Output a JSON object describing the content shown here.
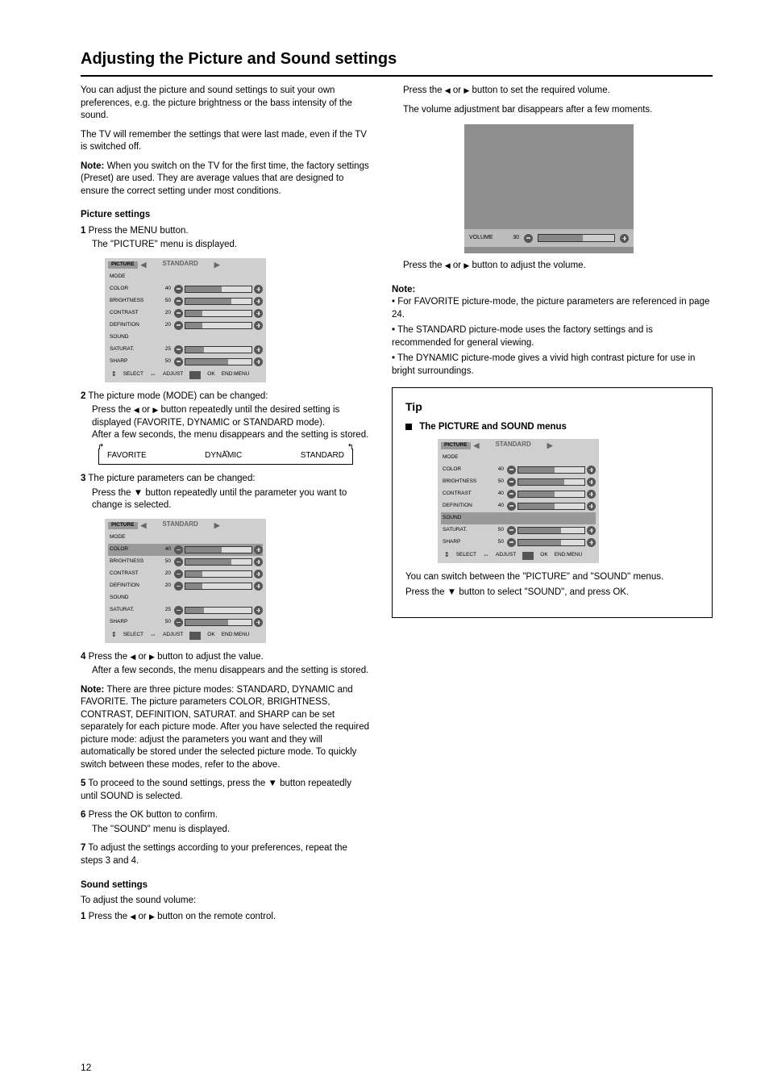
{
  "page": {
    "title": "Adjusting the Picture and Sound settings",
    "number": "12"
  },
  "left": {
    "intro1": "You can adjust the picture and sound settings to suit your own preferences, e.g. the picture brightness or the bass intensity of the sound.",
    "intro2": "The TV will remember the settings that were last made, even if the TV is switched off.",
    "note_head": "Note:",
    "note_body": "When you switch on the TV for the first time, the factory settings (Preset) are used. They are average values that are designed to ensure the correct setting under most conditions.",
    "pic_head": "Picture settings",
    "step1_num": "1",
    "step1": "Press the MENU button.",
    "step1_body": "The \"PICTURE\" menu is displayed.",
    "step2_num": "2",
    "step2_a": "The picture mode (MODE) can be changed:",
    "step2_b": "Press the   ",
    "step2_c": " or   ",
    "step2_d": " button repeatedly until the desired setting is displayed (FAVORITE, DYNAMIC or STANDARD mode).",
    "step2_body": "After a few seconds, the menu disappears and the setting is stored.",
    "mode_items": [
      "FAVORITE",
      "DYNAMIC",
      "STANDARD"
    ],
    "step3_num": "3",
    "step3": "The picture parameters can be changed:",
    "step3_a": "Press the ▼ button repeatedly until the parameter you want to change is selected.",
    "step4_num": "4",
    "step4": "Press the ",
    "step4_b": " or ",
    "step4_c": " button to adjust the value.",
    "step4_body": "After a few seconds, the menu disappears and the setting is stored.",
    "note2_head": "Note:",
    "note2_body": "There are three picture modes: STANDARD, DYNAMIC and FAVORITE. The picture parameters COLOR, BRIGHTNESS, CONTRAST, DEFINITION, SATURAT. and SHARP can be set separately for each picture mode. After you have selected the required picture mode: adjust the parameters you want and they will automatically be stored under the selected picture mode. To quickly switch between these modes, refer to the above.",
    "step5_num": "5",
    "step5": "To proceed to the sound settings, press the ▼ button repeatedly until SOUND is selected.",
    "step6_num": "6",
    "step6": "Press the OK button to confirm.",
    "step6_body": "The \"SOUND\" menu is displayed.",
    "step7_num": "7",
    "step7": "To adjust the settings according to your preferences, repeat the steps 3 and 4.",
    "sound_head": "Sound settings",
    "snd_pre": "To adjust the sound volume:",
    "snd_step_num": "1",
    "snd_step": "Press the ",
    "snd_step_b": " or ",
    "snd_step_c": " button on the remote control."
  },
  "right": {
    "line1_a": "Press the ",
    "line1_b": " or ",
    "line1_c": " button to set the required volume.",
    "line1_body": "The volume adjustment bar disappears after a few moments.",
    "line2_a": "  Press the ",
    "line2_b": " or ",
    "line2_c": " button to adjust the volume.",
    "note_head": "Note:",
    "note1": "For FAVORITE picture-mode, the picture parameters are referenced in page 24.",
    "note2": "The STANDARD picture-mode uses the factory settings and is recommended for general viewing.",
    "note3": "The DYNAMIC picture-mode gives a vivid high contrast picture for use in bright surroundings.",
    "tip_head": "Tip",
    "tip_sub": "The PICTURE and SOUND menus",
    "tip_body_a": "You can switch between the \"PICTURE\" and \"SOUND\" menus.",
    "tip_body_b": "Press the ▼ button to select \"SOUND\", and press OK."
  },
  "osd_pic": {
    "head_label": "PICTURE",
    "title": "STANDARD",
    "rows": [
      {
        "label": "MODE",
        "val": "",
        "fill": 0,
        "bar": false
      },
      {
        "label": "COLOR",
        "val": "40",
        "fill": 55
      },
      {
        "label": "BRIGHTNESS",
        "val": "50",
        "fill": 70
      },
      {
        "label": "CONTRAST",
        "val": "20",
        "fill": 25
      },
      {
        "label": "DEFINITION",
        "val": "20",
        "fill": 25
      }
    ],
    "rows2": [
      {
        "label": "SATURAT.",
        "val": "25",
        "fill": 28
      },
      {
        "label": "SHARP",
        "val": "50",
        "fill": 65
      }
    ],
    "sound_label": "SOUND",
    "foot_sel": "SELECT",
    "foot_adj": "ADJUST",
    "foot_ok": "OK",
    "foot_end": "END:MENU"
  },
  "osd_pic2": {
    "head_label": "PICTURE",
    "title": "STANDARD",
    "rows": [
      {
        "label": "MODE",
        "val": "",
        "fill": 0,
        "bar": false
      },
      {
        "label": "COLOR",
        "val": "40",
        "fill": 55
      },
      {
        "label": "BRIGHTNESS",
        "val": "50",
        "fill": 70
      },
      {
        "label": "CONTRAST",
        "val": "20",
        "fill": 25
      },
      {
        "label": "DEFINITION",
        "val": "20",
        "fill": 25
      }
    ],
    "rows2": [
      {
        "label": "SATURAT.",
        "val": "25",
        "fill": 28
      },
      {
        "label": "SHARP",
        "val": "50",
        "fill": 65
      }
    ],
    "sel_row": "COLOR",
    "sound_label": "SOUND",
    "foot_sel": "SELECT",
    "foot_adj": "ADJUST",
    "foot_ok": "OK",
    "foot_end": "END:MENU"
  },
  "osd_callout": {
    "head_label": "PICTURE",
    "title": "STANDARD",
    "rows": [
      {
        "label": "MODE",
        "val": "",
        "fill": 0,
        "bar": false
      },
      {
        "label": "COLOR",
        "val": "40",
        "fill": 55
      },
      {
        "label": "BRIGHTNESS",
        "val": "50",
        "fill": 70
      },
      {
        "label": "CONTRAST",
        "val": "40",
        "fill": 55
      },
      {
        "label": "DEFINITION",
        "val": "40",
        "fill": 55
      }
    ],
    "rows2": [
      {
        "label": "SATURAT.",
        "val": "50",
        "fill": 65
      },
      {
        "label": "SHARP",
        "val": "50",
        "fill": 65
      }
    ],
    "sel_row": "SOUND",
    "sound_label": "SOUND",
    "foot_sel": "SELECT",
    "foot_adj": "ADJUST",
    "foot_ok": "OK",
    "foot_end": "END:MENU"
  },
  "vol": {
    "label": "VOLUME",
    "value": "30",
    "fill": 58
  }
}
